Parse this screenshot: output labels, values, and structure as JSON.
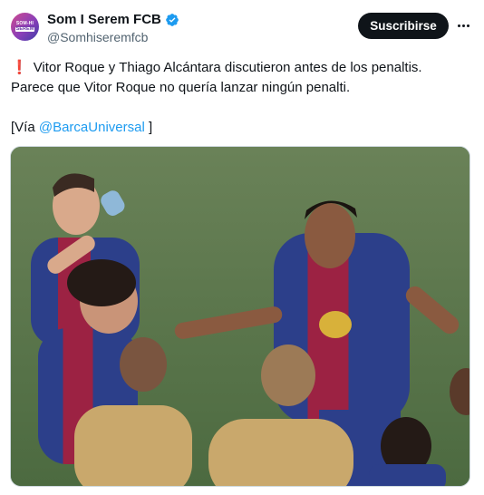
{
  "account": {
    "display_name": "Som I Serem FCB",
    "handle": "@Somhiseremfcb",
    "avatar_text_1": "SOM-HI",
    "avatar_text_2": "SEREM"
  },
  "actions": {
    "subscribe_label": "Suscribirse",
    "more_icon": "more-horizontal-icon"
  },
  "post": {
    "line1": "Vitor Roque y Thiago Alcántara discutieron antes de los penaltis.",
    "line2": "Parece que Vitor Roque no quería lanzar ningún penalti.",
    "via_prefix": "[Vía ",
    "via_link": "@BarcaUniversal",
    "via_suffix": " ]",
    "emoji": "❗"
  },
  "colors": {
    "link": "#1d9bf0",
    "verified": "#1d9bf0",
    "button_bg": "#0f1419",
    "pitch": "#56724a"
  }
}
